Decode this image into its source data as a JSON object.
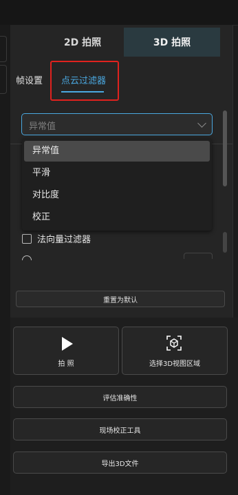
{
  "mode_tabs": {
    "tab_2d": "2D 拍照",
    "tab_3d": "3D 拍照"
  },
  "sub_tabs": {
    "frame_settings": "帧设置",
    "point_cloud_filter": "点云过滤器"
  },
  "filter_select": {
    "value": "异常值",
    "options": [
      "异常值",
      "平滑",
      "对比度",
      "校正"
    ],
    "selected_index": 0
  },
  "normal_filter": {
    "label": "法向量过滤器",
    "checked": false
  },
  "reset_button": "重置为默认",
  "actions": {
    "capture": "拍 照",
    "select_3d_region": "选择3D视图区域",
    "evaluate_accuracy": "评估准确性",
    "field_calibration": "现场校正工具",
    "export_3d": "导出3D文件"
  },
  "colors": {
    "accent": "#4aa8e0",
    "highlight_box": "#e0221e",
    "active_mode_tab": "#2a3a40"
  },
  "icons": {
    "play": "play-icon",
    "chevron": "chevron-down-icon",
    "region": "select-region-icon"
  }
}
